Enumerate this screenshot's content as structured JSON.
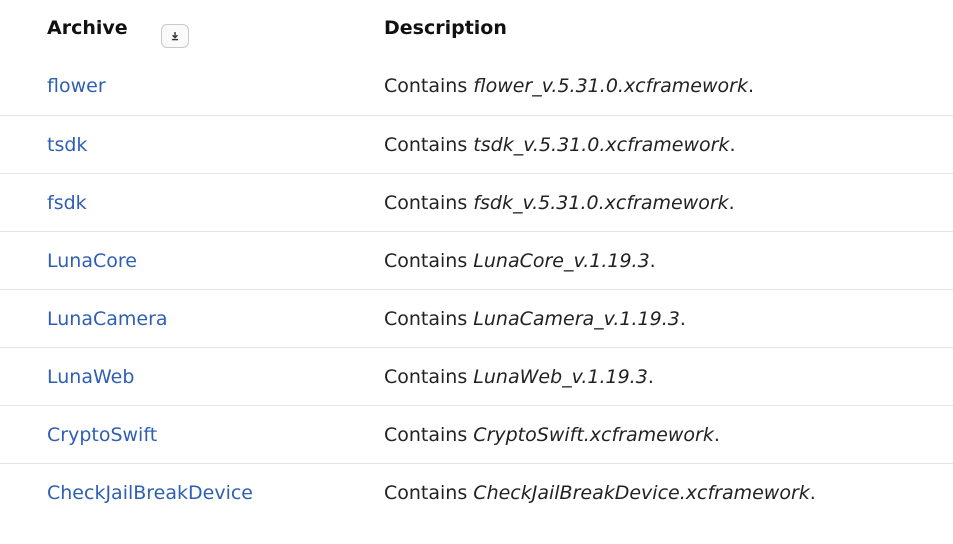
{
  "header": {
    "archive_label": "Archive",
    "description_label": "Description",
    "sort_icon": "download-arrow-icon"
  },
  "colors": {
    "link": "#2f5fb3",
    "text": "#222222",
    "divider": "#e6e6e6"
  },
  "rows": [
    {
      "archive": "flower",
      "prefix": "Contains ",
      "file": "flower_v.5.31.0.xcframework",
      "suffix": "."
    },
    {
      "archive": "tsdk",
      "prefix": "Contains ",
      "file": "tsdk_v.5.31.0.xcframework",
      "suffix": "."
    },
    {
      "archive": "fsdk",
      "prefix": "Contains ",
      "file": "fsdk_v.5.31.0.xcframework",
      "suffix": "."
    },
    {
      "archive": "LunaCore",
      "prefix": "Contains ",
      "file": "LunaCore_v.1.19.3",
      "suffix": "."
    },
    {
      "archive": "LunaCamera",
      "prefix": "Contains ",
      "file": "LunaCamera_v.1.19.3",
      "suffix": "."
    },
    {
      "archive": "LunaWeb",
      "prefix": "Contains ",
      "file": "LunaWeb_v.1.19.3",
      "suffix": "."
    },
    {
      "archive": "CryptoSwift",
      "prefix": "Contains ",
      "file": "CryptoSwift.xcframework",
      "suffix": "."
    },
    {
      "archive": "CheckJailBreakDevice",
      "prefix": "Contains ",
      "file": "CheckJailBreakDevice.xcframework",
      "suffix": "."
    }
  ]
}
